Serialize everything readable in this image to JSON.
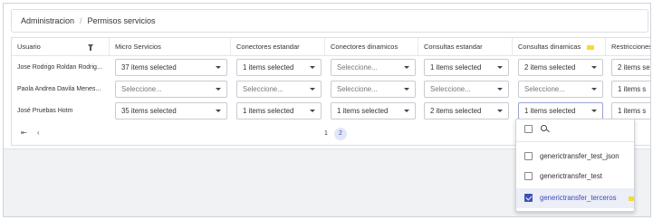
{
  "breadcrumb": {
    "root": "Administracion",
    "separator": "/",
    "current": "Permisos servicios"
  },
  "table": {
    "headers": {
      "usuario": "Usuario",
      "micro": "Micro Servicios",
      "conectores_estandar": "Conectores estandar",
      "conectores_dinamicos": "Conectores dinamicos",
      "consultas_estandar": "Consultas estandar",
      "consultas_dinamicas": "Consultas dinamicas",
      "restricciones": "Restricciones"
    },
    "rows": [
      {
        "usuario": "Jose Rodrigo Roldan Rodrig...",
        "micro": "37 items selected",
        "conectores_estandar": "1 items selected",
        "conectores_dinamicos": "Seleccione...",
        "consultas_estandar": "1 items selected",
        "consultas_dinamicas": "2 items selected",
        "restricciones": "2 items se"
      },
      {
        "usuario": "Paola Andrea Davila Menes...",
        "micro": "Seleccione...",
        "conectores_estandar": "Seleccione...",
        "conectores_dinamicos": "Seleccione...",
        "consultas_estandar": "Seleccione...",
        "consultas_dinamicas": "Seleccione...",
        "restricciones": "1 items s"
      },
      {
        "usuario": "José Pruebas Hotm",
        "micro": "35 items selected",
        "conectores_estandar": "1 items selected",
        "conectores_dinamicos": "1 items selected",
        "consultas_estandar": "2 items selected",
        "consultas_dinamicas": "1 items selected",
        "restricciones": "1 items s"
      }
    ]
  },
  "pager": {
    "first": "⇤",
    "prev": "‹",
    "pages": [
      "1",
      "2"
    ],
    "active_page": "2"
  },
  "dropdown": {
    "options": [
      {
        "label": "generictransfer_test_json",
        "checked": false
      },
      {
        "label": "generictransfer_test",
        "checked": false
      },
      {
        "label": "generictransfer_terceros",
        "checked": true
      }
    ]
  },
  "colors": {
    "accent": "#3f51b5",
    "marker": "#f7dc2d",
    "selected_row_bg": "#eceef8"
  }
}
